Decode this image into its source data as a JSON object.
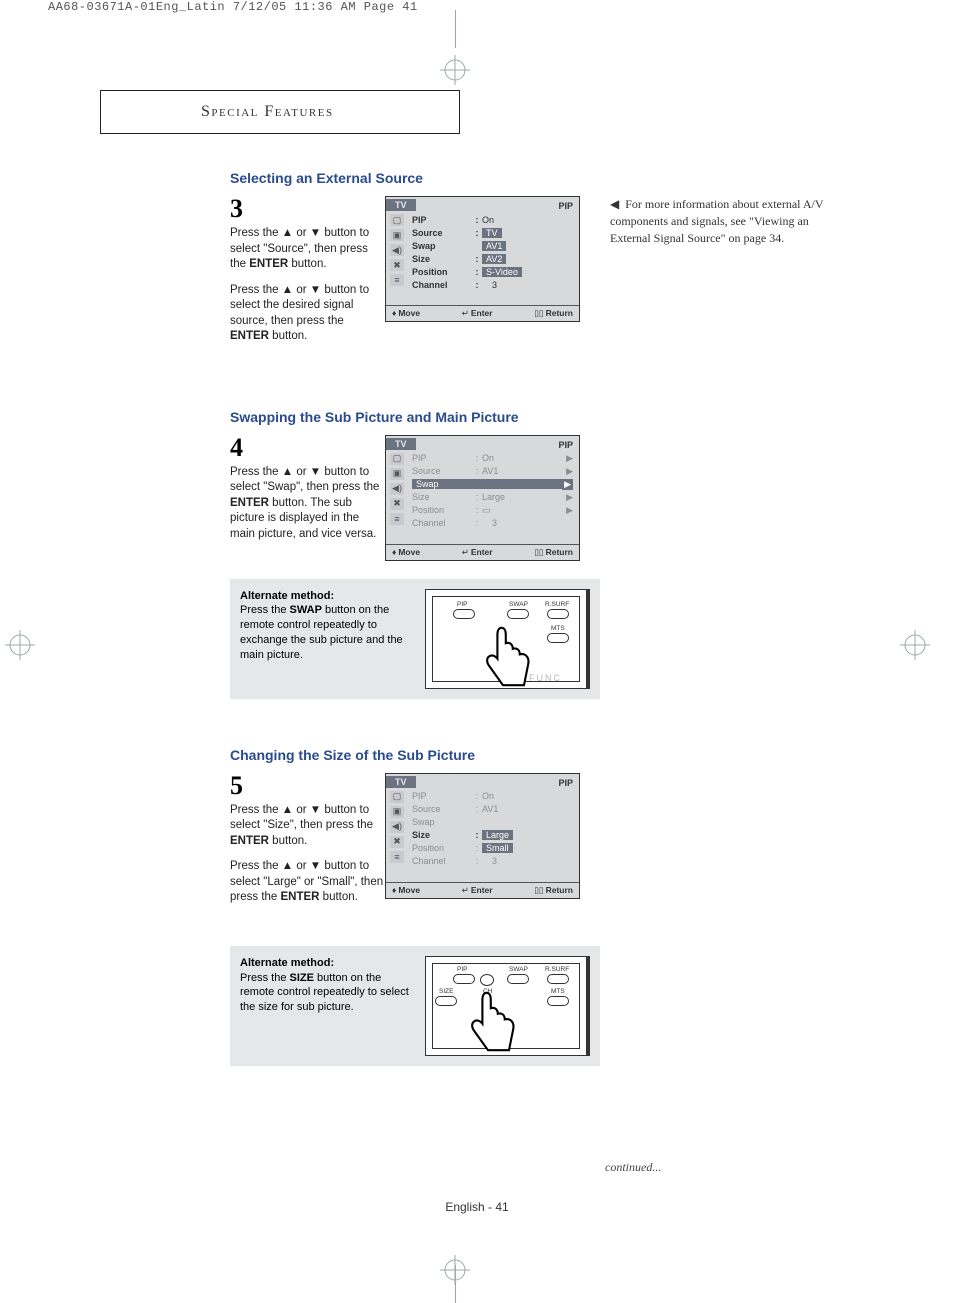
{
  "print_header": "AA68-03671A-01Eng_Latin  7/12/05  11:36 AM  Page 41",
  "section_title": "Special Features",
  "sub1_heading": "Selecting an External Source",
  "step3_num": "3",
  "step3_p1a": "Press the ▲ or ▼ button to select \"Source\", then press the ",
  "step3_p1b": "ENTER",
  "step3_p1c": " button.",
  "step3_p2a": "Press the ▲ or ▼ button to select the desired signal source, then press the ",
  "step3_p2b": "ENTER",
  "step3_p2c": " button.",
  "side_note": "For more information about external A/V components and signals, see \"Viewing an External Signal Source\" on page 34.",
  "sub2_heading": "Swapping the Sub Picture and Main Picture",
  "step4_num": "4",
  "step4_p1a": "Press the ▲ or ▼ button to select \"Swap\", then press the ",
  "step4_p1b": "ENTER",
  "step4_p1c": " button. The sub picture is displayed in the main picture, and vice versa.",
  "alt1_title": "Alternate method:",
  "alt1_body_a": "Press the ",
  "alt1_body_b": "SWAP",
  "alt1_body_c": " button on the remote control repeatedly to exchange the sub picture and the main picture.",
  "sub3_heading": "Changing the Size of the Sub Picture",
  "step5_num": "5",
  "step5_p1a": "Press the ▲ or ▼ button to select \"Size\", then press the ",
  "step5_p1b": "ENTER",
  "step5_p1c": " button.",
  "step5_p2a": "Press the ▲ or ▼ button to select \"Large\" or \"Small\", then press the ",
  "step5_p2b": "ENTER",
  "step5_p2c": " button.",
  "alt2_title": "Alternate method:",
  "alt2_body_a": "Press the ",
  "alt2_body_b": "SIZE",
  "alt2_body_c": " button on the remote control repeatedly to select the size for sub picture.",
  "osd": {
    "tv": "TV",
    "pip_label": "PIP",
    "move": "Move",
    "enter": "Enter",
    "return": "Return",
    "labels": {
      "pip": "PIP",
      "source": "Source",
      "swap": "Swap",
      "size": "Size",
      "position": "Position",
      "channel": "Channel"
    },
    "vals3": {
      "pip": "On",
      "source_opts": [
        "TV",
        "AV1",
        "AV2",
        "S-Video"
      ],
      "channel": "3"
    },
    "vals4": {
      "pip": "On",
      "source": "AV1",
      "size": "Large",
      "position": "▭",
      "channel": "3"
    },
    "vals5": {
      "pip": "On",
      "source": "AV1",
      "size_opts": [
        "Large",
        "Small"
      ],
      "channel": "3"
    }
  },
  "remote_labels": {
    "pip": "PIP",
    "swap": "SWAP",
    "rsurf": "R.SURF",
    "mts": "MTS",
    "size": "SIZE",
    "ch": "CH",
    "func_ghost": "FUNC"
  },
  "continued": "continued...",
  "pagenum": "English - 41"
}
